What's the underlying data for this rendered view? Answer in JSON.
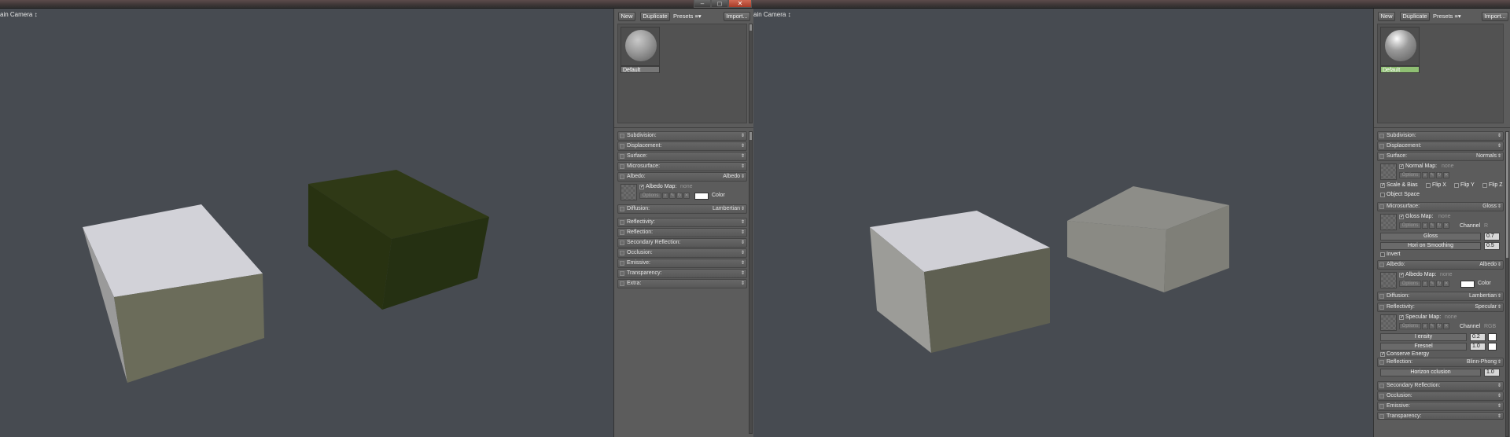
{
  "window": {
    "min_label": "–",
    "max_label": "◻",
    "close_label": "✕"
  },
  "left": {
    "viewport": {
      "camera_label": "ain Camera ↕"
    },
    "toolbar": {
      "new": "New",
      "duplicate": "Duplicate",
      "presets": "Presets ≡▾",
      "import": "Import..."
    },
    "material": {
      "name": "Default"
    },
    "albedo_sub": {
      "map_label": "Albedo Map:",
      "map_value": "none",
      "options": "Options",
      "color_label": "Color"
    },
    "sections": [
      {
        "label": "Subdivision:",
        "value": ""
      },
      {
        "label": "Displacement:",
        "value": ""
      },
      {
        "label": "Surface:",
        "value": ""
      },
      {
        "label": "Microsurface:",
        "value": ""
      },
      {
        "label": "Albedo:",
        "value": "Albedo"
      },
      {
        "label": "Diffusion:",
        "value": "Lambertian"
      },
      {
        "label": "Reflectivity:",
        "value": ""
      },
      {
        "label": "Reflection:",
        "value": ""
      },
      {
        "label": "Secondary Reflection:",
        "value": ""
      },
      {
        "label": "Occlusion:",
        "value": ""
      },
      {
        "label": "Emissive:",
        "value": ""
      },
      {
        "label": "Transparency:",
        "value": ""
      },
      {
        "label": "Extra:",
        "value": ""
      }
    ]
  },
  "right": {
    "viewport": {
      "camera_label": "ain Camera ↕"
    },
    "toolbar": {
      "new": "New",
      "duplicate": "Duplicate",
      "presets": "Presets ≡▾",
      "import": "Import..."
    },
    "material": {
      "name": "Default"
    },
    "sections": {
      "subdivision": {
        "label": "Subdivision:",
        "value": ""
      },
      "displacement": {
        "label": "Displacement:",
        "value": ""
      },
      "surface": {
        "label": "Surface:",
        "value": "Normals"
      },
      "microsurface": {
        "label": "Microsurface:",
        "value": "Gloss"
      },
      "albedo": {
        "label": "Albedo:",
        "value": "Albedo"
      },
      "diffusion": {
        "label": "Diffusion:",
        "value": "Lambertian"
      },
      "reflectivity": {
        "label": "Reflectivity:",
        "value": "Specular"
      },
      "reflection": {
        "label": "Reflection:",
        "value": "Blinn-Phong"
      },
      "secondary_reflection": {
        "label": "Secondary Reflection:",
        "value": ""
      },
      "occlusion": {
        "label": "Occlusion:",
        "value": ""
      },
      "emissive": {
        "label": "Emissive:",
        "value": ""
      },
      "transparency": {
        "label": "Transparency:",
        "value": ""
      }
    },
    "surface_sub": {
      "map_label": "Normal Map:",
      "map_value": "none",
      "options": "Options",
      "scale_bias": "Scale & Bias",
      "flip_x": "Flip X",
      "flip_y": "Flip Y",
      "flip_z": "Flip Z",
      "object_space": "Object Space"
    },
    "micro_sub": {
      "map_label": "Gloss Map:",
      "map_value": "none",
      "options": "Options",
      "channel_label": "Channel",
      "channel_value": "R",
      "gloss_label": "Gloss",
      "gloss_value": "0.7",
      "horizon_label": "Hori  on Smoothing",
      "horizon_value": "0.5",
      "invert": "Invert"
    },
    "albedo_sub": {
      "map_label": "Albedo Map:",
      "map_value": "none",
      "options": "Options",
      "color_label": "Color"
    },
    "reflectivity_sub": {
      "map_label": "Specular Map:",
      "map_value": "none",
      "options": "Options",
      "channel_label": "Channel",
      "channel_value": "RGB",
      "intensity_label": "I   ensity",
      "intensity_value": "0.2",
      "fresnel_label": "Fresnel",
      "fresnel_value": "1.0",
      "conserve": "Conserve Energy"
    },
    "reflection_sub": {
      "horizon_label": "Horizon  cclusion",
      "horizon_value": "1.0"
    }
  },
  "colors": {
    "viewport_bg": "#474b51",
    "panel_bg": "#5c5c5c",
    "selected_material": "#8fbf73",
    "cube_light_top": "#d3d3d9",
    "cube_light_front": "#6a6b5a",
    "cube_dark": "#2a3414",
    "cube_grey": "#8a8a84"
  }
}
